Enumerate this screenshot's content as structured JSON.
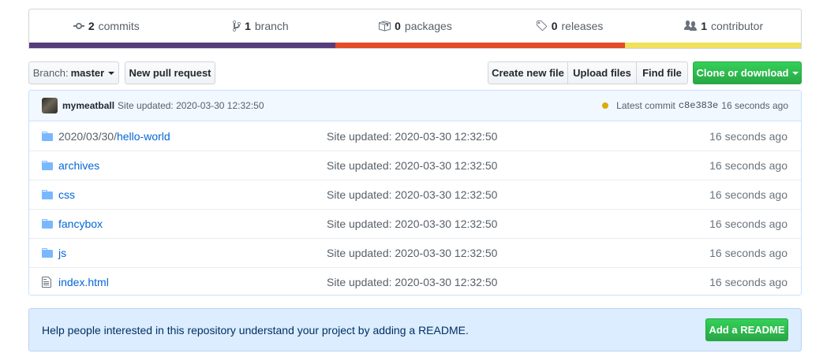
{
  "summary": {
    "commits": {
      "num": "2",
      "label": "commits",
      "icon": "commit-icon"
    },
    "branches": {
      "num": "1",
      "label": "branch",
      "icon": "branch-icon"
    },
    "packages": {
      "num": "0",
      "label": "packages",
      "icon": "package-icon"
    },
    "releases": {
      "num": "0",
      "label": "releases",
      "icon": "tag-icon"
    },
    "contributors": {
      "num": "1",
      "label": "contributor",
      "icon": "people-icon"
    }
  },
  "language_bar": [
    {
      "color": "#563d7c",
      "share": 0.397
    },
    {
      "color": "#e34c26",
      "share": 0.375
    },
    {
      "color": "#f1e05a",
      "share": 0.228
    }
  ],
  "toolbar": {
    "branch_prefix": "Branch:",
    "branch_name": "master",
    "new_pull_request": "New pull request",
    "create_new_file": "Create new file",
    "upload_files": "Upload files",
    "find_file": "Find file",
    "clone_or_download": "Clone or download"
  },
  "commit": {
    "author": "mymeatball",
    "message": "Site updated: 2020-03-30 12:32:50",
    "latest_label": "Latest commit",
    "sha": "c8e383e",
    "age": "16 seconds ago",
    "status_color": "#dbab09"
  },
  "files": [
    {
      "type": "directory",
      "dim_prefix": "2020/03/30/",
      "name": "hello-world",
      "message": "Site updated: 2020-03-30 12:32:50",
      "age": "16 seconds ago"
    },
    {
      "type": "directory",
      "dim_prefix": "",
      "name": "archives",
      "message": "Site updated: 2020-03-30 12:32:50",
      "age": "16 seconds ago"
    },
    {
      "type": "directory",
      "dim_prefix": "",
      "name": "css",
      "message": "Site updated: 2020-03-30 12:32:50",
      "age": "16 seconds ago"
    },
    {
      "type": "directory",
      "dim_prefix": "",
      "name": "fancybox",
      "message": "Site updated: 2020-03-30 12:32:50",
      "age": "16 seconds ago"
    },
    {
      "type": "directory",
      "dim_prefix": "",
      "name": "js",
      "message": "Site updated: 2020-03-30 12:32:50",
      "age": "16 seconds ago"
    },
    {
      "type": "file",
      "dim_prefix": "",
      "name": "index.html",
      "message": "Site updated: 2020-03-30 12:32:50",
      "age": "16 seconds ago"
    }
  ],
  "readme_prompt": {
    "text": "Help people interested in this repository understand your project by adding a README.",
    "button": "Add a README"
  }
}
